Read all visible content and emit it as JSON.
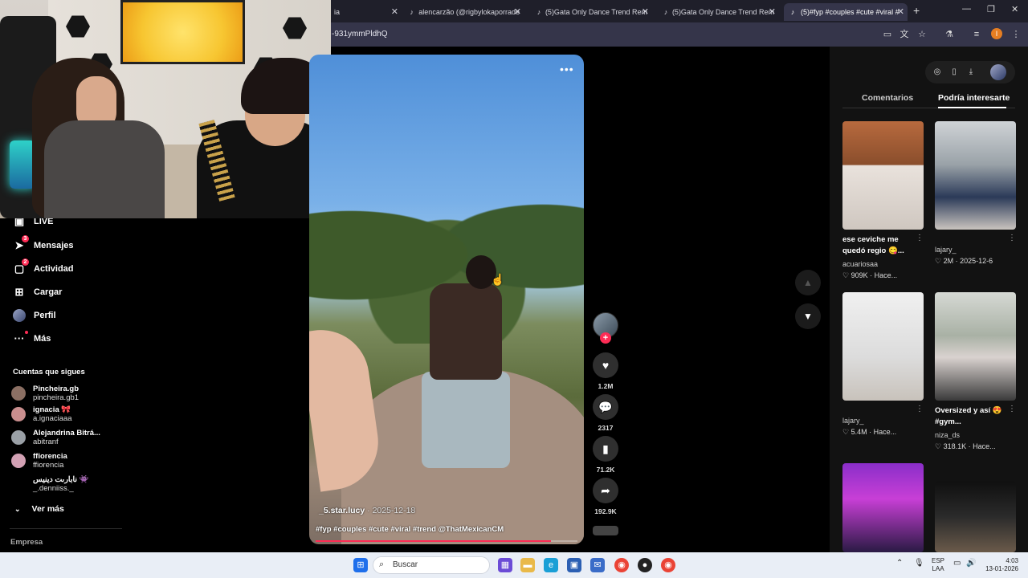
{
  "browser": {
    "tabs": [
      {
        "label": "ia",
        "active": false
      },
      {
        "label": "alencarzão (@rigbylokaporrade",
        "active": false
      },
      {
        "label": "(5)Gata Only Dance Trend Rem",
        "active": false
      },
      {
        "label": "(5)Gata Only Dance Trend Rem",
        "active": false
      },
      {
        "label": "(5)#fyp #couples #cute #viral #",
        "active": true
      }
    ],
    "url": "-931ymmPldhQ",
    "profile_initial": "I"
  },
  "sidebar": {
    "nav": [
      {
        "label": "LIVE",
        "icon": "live-icon",
        "glyph": "▣",
        "badge": ""
      },
      {
        "label": "Mensajes",
        "icon": "messages-icon",
        "glyph": "➤",
        "badge": "3"
      },
      {
        "label": "Actividad",
        "icon": "activity-icon",
        "glyph": "▢",
        "badge": "2"
      },
      {
        "label": "Cargar",
        "icon": "upload-icon",
        "glyph": "⊞",
        "badge": ""
      },
      {
        "label": "Perfil",
        "icon": "profile-icon",
        "glyph": "◉",
        "badge": ""
      },
      {
        "label": "Más",
        "icon": "more-icon",
        "glyph": "···",
        "badge": ""
      }
    ],
    "following_title": "Cuentas que sigues",
    "following": [
      {
        "name": "Pincheira.gb",
        "handle": "pincheira.gb1",
        "color": "#8b6f63"
      },
      {
        "name": "ignacia 🎀",
        "handle": "a.ignaciaaa",
        "color": "#c98e8e"
      },
      {
        "name": "Alejandrina Bitrá...",
        "handle": "abitranf",
        "color": "#9aa0a6"
      },
      {
        "name": "ffiorencia",
        "handle": "ffiorencia",
        "color": "#d2a1b4"
      },
      {
        "name": "نابارىت دينيس 👾",
        "handle": "_.denniiss._",
        "color": "#000000"
      }
    ],
    "see_more": "Ver más",
    "footer": "Empresa"
  },
  "video": {
    "author": "_5.star.lucy",
    "date": "2025-12-18",
    "caption": "#fyp #couples #cute #viral #trend @ThatMexicanCM",
    "progress_fraction": 0.9
  },
  "actions": {
    "likes": "1.2M",
    "comments": "2317",
    "saves": "71.2K",
    "shares": "192.9K"
  },
  "right_panel": {
    "tabs": [
      "Comentarios",
      "Podría interesarte"
    ],
    "active_tab": "Podría interesarte",
    "items": [
      {
        "desc": "ese ceviche me quedó regio 😋...",
        "author": "acuariosaa",
        "stats": "♡ 909K · Hace...",
        "thumb": "linear-gradient(180deg,#b86a3e,#8a4e2c 40%,#e9e2dc 41%,#cfc7c0)"
      },
      {
        "desc": "",
        "author": "lajary_",
        "stats": "♡ 2M · 2025-12-6",
        "thumb": "linear-gradient(180deg,#cfd3d6,#9aa2a8 40%,#2b3a58 70%,#c9c4bf)"
      },
      {
        "desc": "",
        "author": "lajary_",
        "stats": "♡ 5.4M · Hace...",
        "thumb": "linear-gradient(180deg,#f0f0f0,#dcdcdc 60%,#c8c2bb)"
      },
      {
        "desc": "Oversized y así 😍 #gym...",
        "author": "niza_ds",
        "stats": "♡ 318.1K · Hace...",
        "thumb": "linear-gradient(180deg,#d6d9d4,#a9b1a5 40%,#d9d2cf 60%,#3a3a3a)"
      },
      {
        "desc": "",
        "author": "",
        "stats": "",
        "thumb": "linear-gradient(180deg,#8a2ec9,#c83fd6 40%,#2a1a44)"
      },
      {
        "desc": "",
        "author": "",
        "stats": "",
        "thumb": "linear-gradient(180deg,#101010,#2b2b2b 50%,#6a5a4a)"
      }
    ]
  },
  "taskbar": {
    "search_label": "Buscar",
    "lang_line1": "ESP",
    "lang_line2": "LAA",
    "time": "4:03",
    "date": "13-01-2026"
  }
}
